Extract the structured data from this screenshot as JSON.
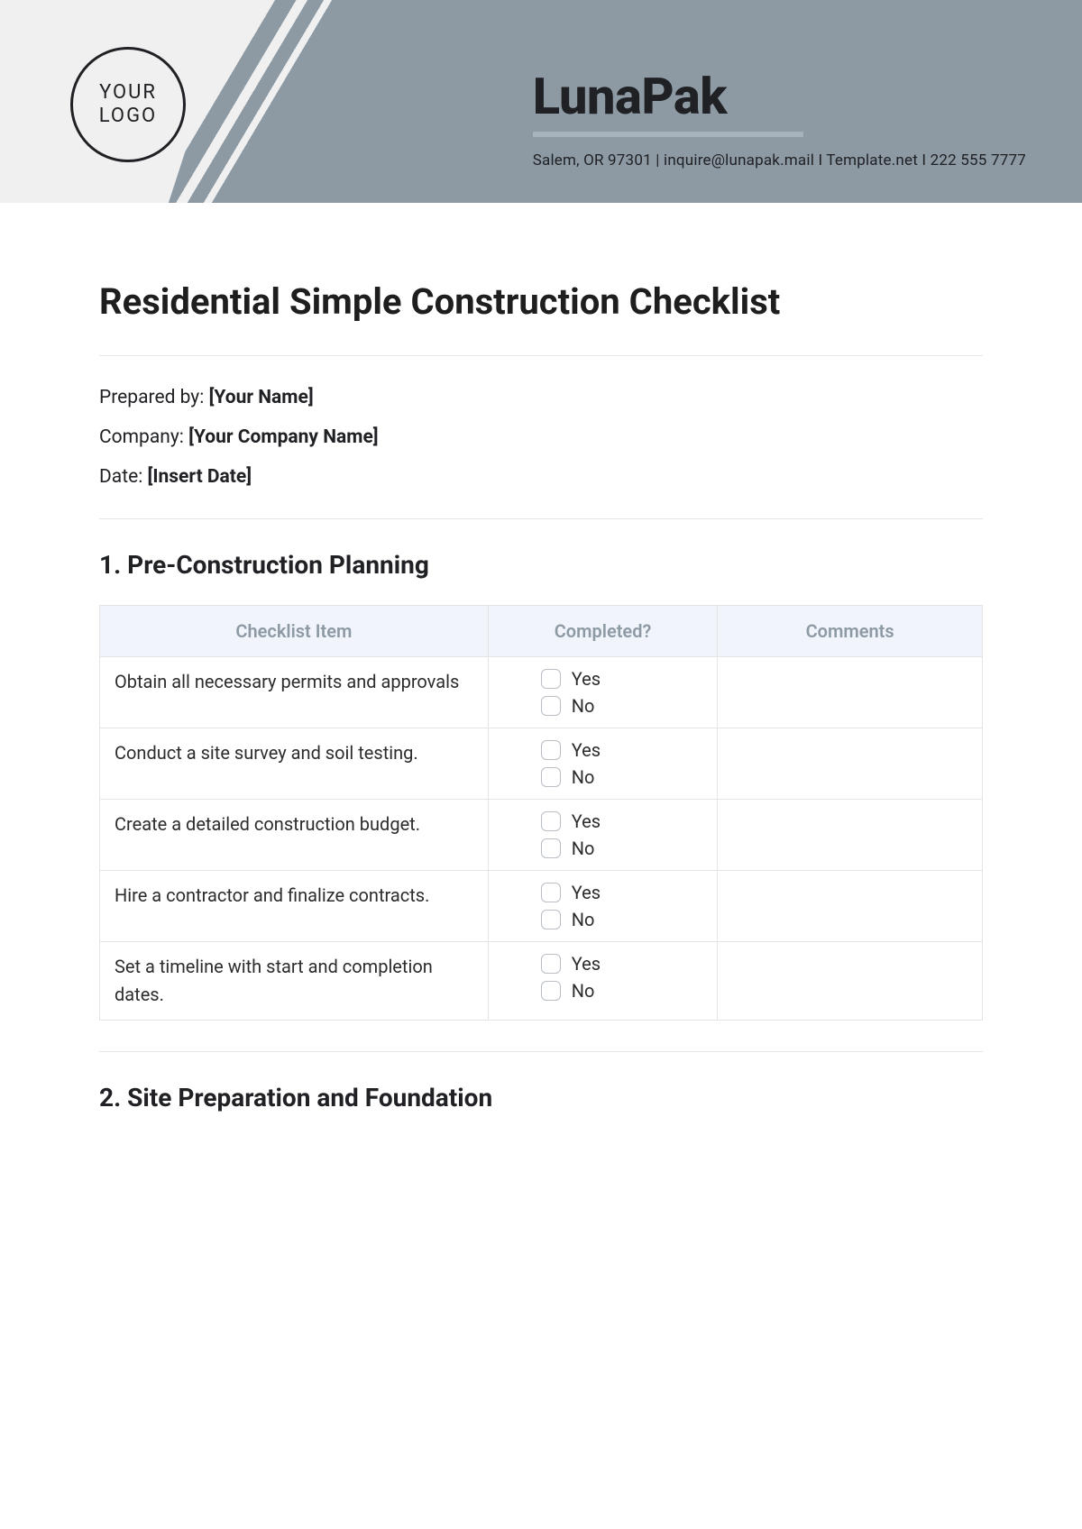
{
  "header": {
    "logo_line1": "YOUR",
    "logo_line2": "LOGO",
    "company_name": "LunaPak",
    "contact": "Salem, OR 97301 | inquire@lunapak.mail  I  Template.net I  222 555 7777"
  },
  "document": {
    "title": "Residential Simple Construction Checklist",
    "meta": {
      "prepared_by_label": "Prepared by:",
      "prepared_by_value": "[Your Name]",
      "company_label": "Company:",
      "company_value": "[Your Company Name]",
      "date_label": "Date:",
      "date_value": "[Insert Date]"
    }
  },
  "sections": [
    {
      "title": "1. Pre-Construction Planning",
      "columns": {
        "item": "Checklist Item",
        "completed": "Completed?",
        "comments": "Comments"
      },
      "rows": [
        {
          "item": "Obtain all necessary permits and approvals",
          "comments": ""
        },
        {
          "item": "Conduct a site survey and soil testing.",
          "comments": ""
        },
        {
          "item": "Create a detailed construction budget.",
          "comments": ""
        },
        {
          "item": "Hire a contractor and finalize contracts.",
          "comments": ""
        },
        {
          "item": "Set a timeline with start and completion dates.",
          "comments": ""
        }
      ]
    },
    {
      "title": "2. Site Preparation and Foundation"
    }
  ],
  "yn": {
    "yes": "Yes",
    "no": "No"
  }
}
